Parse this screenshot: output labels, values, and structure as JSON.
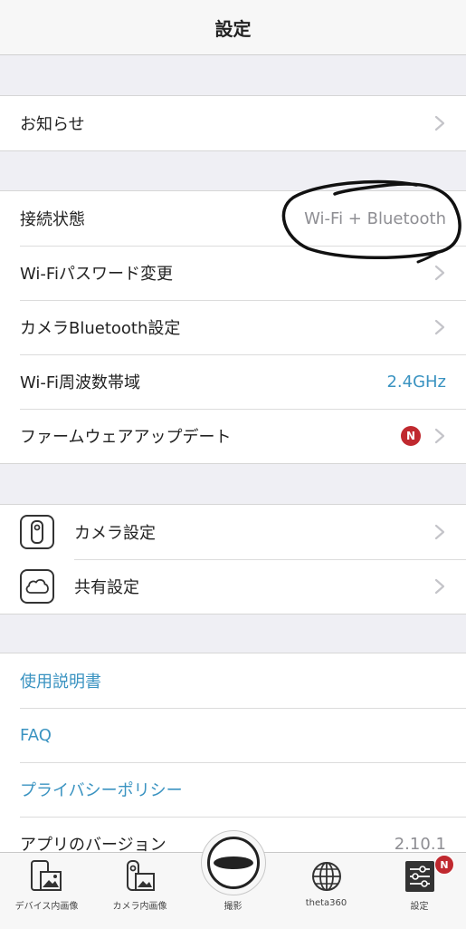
{
  "nav": {
    "title": "設定"
  },
  "notices": {
    "label": "お知らせ"
  },
  "connection": {
    "status_label": "接続状態",
    "status_value": "Wi-Fi + Bluetooth",
    "wifi_password_label": "Wi-Fiパスワード変更",
    "camera_bluetooth_label": "カメラBluetooth設定",
    "wifi_band_label": "Wi-Fi周波数帯域",
    "wifi_band_value": "2.4GHz",
    "firmware_label": "ファームウェアアップデート",
    "firmware_badge": "N"
  },
  "settings": {
    "camera_label": "カメラ設定",
    "share_label": "共有設定"
  },
  "links": {
    "manual": "使用説明書",
    "faq": "FAQ",
    "privacy": "プライバシーポリシー",
    "version_label": "アプリのバージョン",
    "version_value": "2.10.1"
  },
  "tabbar": {
    "device_images": "デバイス内画像",
    "camera_images": "カメラ内画像",
    "capture": "撮影",
    "theta360": "theta360",
    "settings": "設定",
    "settings_badge": "N"
  },
  "colors": {
    "accent_blue": "#3a93c1",
    "badge_red": "#c0292f",
    "background": "#efeff4"
  }
}
